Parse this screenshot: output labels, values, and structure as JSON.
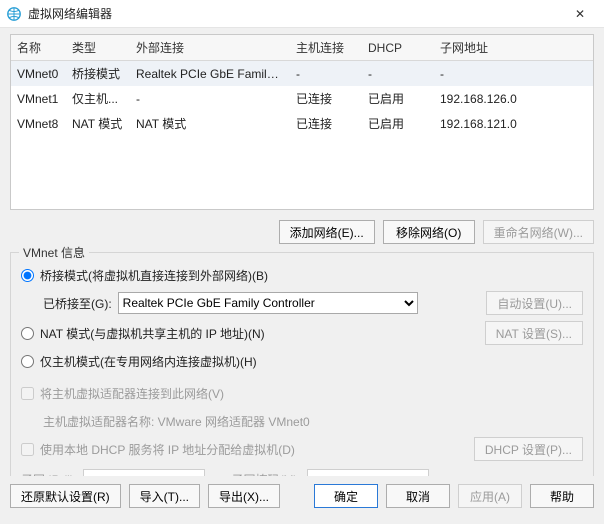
{
  "titlebar": {
    "title": "虚拟网络编辑器",
    "close_label": "✕"
  },
  "table": {
    "headers": {
      "name": "名称",
      "type": "类型",
      "external": "外部连接",
      "host": "主机连接",
      "dhcp": "DHCP",
      "subnet": "子网地址"
    },
    "rows": [
      {
        "name": "VMnet0",
        "type": "桥接模式",
        "external": "Realtek PCIe GbE Family Co...",
        "host": "-",
        "dhcp": "-",
        "subnet": "-"
      },
      {
        "name": "VMnet1",
        "type": "仅主机...",
        "external": "-",
        "host": "已连接",
        "dhcp": "已启用",
        "subnet": "192.168.126.0"
      },
      {
        "name": "VMnet8",
        "type": "NAT 模式",
        "external": "NAT 模式",
        "host": "已连接",
        "dhcp": "已启用",
        "subnet": "192.168.121.0"
      }
    ]
  },
  "net_buttons": {
    "add": "添加网络(E)...",
    "remove": "移除网络(O)",
    "rename": "重命名网络(W)..."
  },
  "groupbox": {
    "legend": "VMnet 信息",
    "radio_bridge": "桥接模式(将虚拟机直接连接到外部网络)(B)",
    "bridge_to_label": "已桥接至(G):",
    "bridge_to_value": "Realtek PCIe GbE Family Controller",
    "auto_settings": "自动设置(U)...",
    "radio_nat": "NAT 模式(与虚拟机共享主机的 IP 地址)(N)",
    "nat_settings": "NAT 设置(S)...",
    "radio_host": "仅主机模式(在专用网络内连接虚拟机)(H)",
    "chk_host_adapter": "将主机虚拟适配器连接到此网络(V)",
    "host_adapter_hint": "主机虚拟适配器名称: VMware 网络适配器 VMnet0",
    "chk_dhcp": "使用本地 DHCP 服务将 IP 地址分配给虚拟机(D)",
    "dhcp_settings": "DHCP 设置(P)...",
    "subnet_ip_label": "子网 IP (I):",
    "subnet_mask_label": "子网掩码(M):"
  },
  "bottom": {
    "restore": "还原默认设置(R)",
    "import": "导入(T)...",
    "export": "导出(X)...",
    "ok": "确定",
    "cancel": "取消",
    "apply": "应用(A)",
    "help": "帮助"
  },
  "icons": {
    "app": "globe-network-icon",
    "close": "close-icon"
  }
}
